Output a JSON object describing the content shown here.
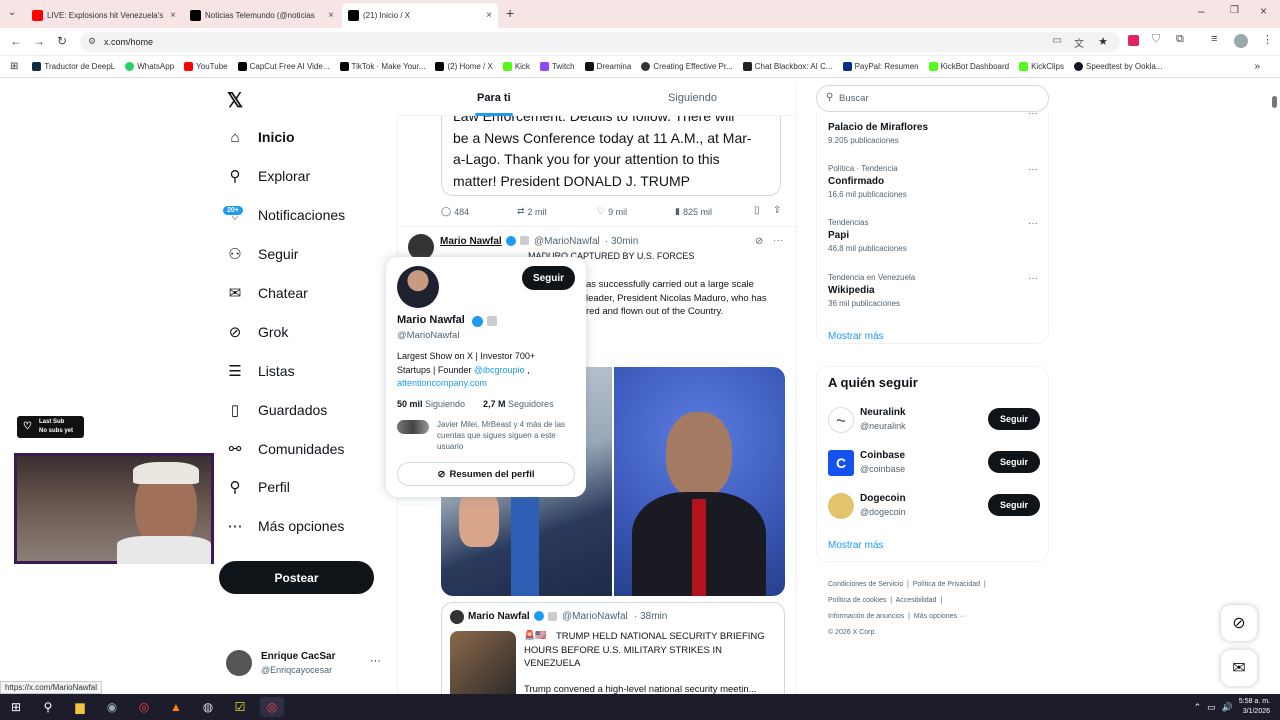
{
  "browser": {
    "tabs": [
      {
        "label": "LIVE: Explosions hit Venezuela's",
        "favicon_color": "#ff0000"
      },
      {
        "label": "Noticias Telemundo (@noticias",
        "favicon_color": "#000000"
      },
      {
        "label": "(21) Inicio / X",
        "favicon_color": "#000000"
      }
    ],
    "new_tab": "+",
    "url": "x.com/home",
    "bookmarks": [
      {
        "label": "Traductor de DeepL",
        "color": "#0f2b46"
      },
      {
        "label": "WhatsApp",
        "color": "#25d366"
      },
      {
        "label": "YouTube",
        "color": "#ff0000"
      },
      {
        "label": "CapCut Free AI Vide...",
        "color": "#000000"
      },
      {
        "label": "TikTok · Make Your...",
        "color": "#000000"
      },
      {
        "label": "(2) Home / X",
        "color": "#000000"
      },
      {
        "label": "Kick",
        "color": "#53fc18"
      },
      {
        "label": "Twitch",
        "color": "#9146ff"
      },
      {
        "label": "Dreamina",
        "color": "#111111"
      },
      {
        "label": "Creating Effective Pr...",
        "color": "#333333"
      },
      {
        "label": "Chat Blackbox: AI C...",
        "color": "#222222"
      },
      {
        "label": "PayPal: Resumen",
        "color": "#003087"
      },
      {
        "label": "KickBot Dashboard",
        "color": "#53fc18"
      },
      {
        "label": "KickClips",
        "color": "#53fc18"
      },
      {
        "label": "Speedtest by Ookla...",
        "color": "#141526"
      }
    ]
  },
  "nav": {
    "items": [
      {
        "label": "Inicio",
        "icon": "home-icon",
        "glyph": "⌂"
      },
      {
        "label": "Explorar",
        "icon": "search-icon",
        "glyph": "⚲"
      },
      {
        "label": "Notificaciones",
        "icon": "bell-icon",
        "glyph": "♢"
      },
      {
        "label": "Seguir",
        "icon": "person-add-icon",
        "glyph": "⚇"
      },
      {
        "label": "Chatear",
        "icon": "mail-icon",
        "glyph": "✉"
      },
      {
        "label": "Grok",
        "icon": "grok-icon",
        "glyph": "⊘"
      },
      {
        "label": "Listas",
        "icon": "list-icon",
        "glyph": "☰"
      },
      {
        "label": "Guardados",
        "icon": "bookmark-icon",
        "glyph": "▯"
      },
      {
        "label": "Comunidades",
        "icon": "communities-icon",
        "glyph": "⚯"
      },
      {
        "label": "Perfil",
        "icon": "profile-icon",
        "glyph": "⚲"
      },
      {
        "label": "Más opciones",
        "icon": "more-circle-icon",
        "glyph": "⋯"
      }
    ],
    "notif_badge": "20+",
    "post_button": "Postear",
    "account": {
      "name": "Enrique CacSar",
      "handle": "@Enriqcayocesar"
    }
  },
  "feed": {
    "tabs": [
      "Para ti",
      "Siguiendo"
    ],
    "tweet1": {
      "text_lines": [
        "Law Enforcement. Details to follow. There will",
        "be a News Conference today at 11 A.M., at Mar-",
        "a-Lago. Thank you for your attention to this",
        "matter! President DONALD J. TRUMP"
      ],
      "replies": "484",
      "reposts": "2 mil",
      "likes": "9 mil",
      "views": "825 mil"
    },
    "tweet2": {
      "name": "Mario Nawfal",
      "handle": "@MarioNawfal",
      "time": "· 30min",
      "headline": "MADURO CAPTURED BY U.S. FORCES",
      "body_lines": [
        "as successfully carried out a large scale",
        "leader, President Nicolas Maduro, who has",
        "red and flown out of the Country."
      ]
    },
    "tweet3": {
      "name": "Mario Nawfal",
      "handle": "@MarioNawfal",
      "time": "· 38min",
      "flags": "🚨🇺🇸",
      "headline": "TRUMP HELD NATIONAL SECURITY BRIEFING HOURS BEFORE U.S. MILITARY STRIKES IN VENEZUELA",
      "body": "Trump convened a high-level national security meetin..."
    }
  },
  "hovercard": {
    "follow_button": "Seguir",
    "name": "Mario Nawfal",
    "handle": "@MarioNawfal",
    "bio_line1": "Largest Show on X | Investor 700+",
    "bio_line2_prefix": "Startups | Founder ",
    "bio_mention": "@ibcgroupio",
    "bio_link": "attentioncompany.com",
    "following_count": "50 mil",
    "following_label": "Siguiendo",
    "followers_count": "2,7 M",
    "followers_label": "Seguidores",
    "mutuals": "Javier Milei, MrBeast y 4 más de las cuentas que sigues siguen a este usuario",
    "summary_button": "Resumen del perfil"
  },
  "right": {
    "search_placeholder": "Buscar",
    "trends": [
      {
        "meta": "",
        "name": "Palacio de Miraflores",
        "count": "9.205 publicaciones"
      },
      {
        "meta": "Política · Tendencia",
        "name": "Confirmado",
        "count": "16,6 mil publicaciones"
      },
      {
        "meta": "Tendencias",
        "name": "Papi",
        "count": "46,8 mil publicaciones"
      },
      {
        "meta": "Tendencia en Venezuela",
        "name": "Wikipedia",
        "count": "36 mil publicaciones"
      }
    ],
    "show_more": "Mostrar más",
    "who_to_follow_title": "A quién seguir",
    "who_to_follow": [
      {
        "name": "Neuralink",
        "handle": "@neuralink",
        "button": "Seguir"
      },
      {
        "name": "Coinbase",
        "handle": "@coinbase",
        "button": "Seguir"
      },
      {
        "name": "Dogecoin",
        "handle": "@dogecoin",
        "button": "Seguir"
      }
    ],
    "show_more_2": "Mostrar más",
    "footer": [
      "Condiciones de Servicio",
      "Política de Privacidad",
      "Política de cookies",
      "Accesibilidad",
      "Información de anuncios",
      "Más opciones ···",
      "© 2026 X Corp."
    ]
  },
  "overlay": {
    "sub_widget_line1": "Last Sub",
    "sub_widget_line2": "No subs yet"
  },
  "statusbar_url": "https://x.com/MarioNawfal",
  "taskbar": {
    "time": "5:58 a. m.",
    "date": "3/1/2026"
  },
  "colors": {
    "accent": "#1d9bf0",
    "text": "#0f1419",
    "muted": "#536471"
  }
}
